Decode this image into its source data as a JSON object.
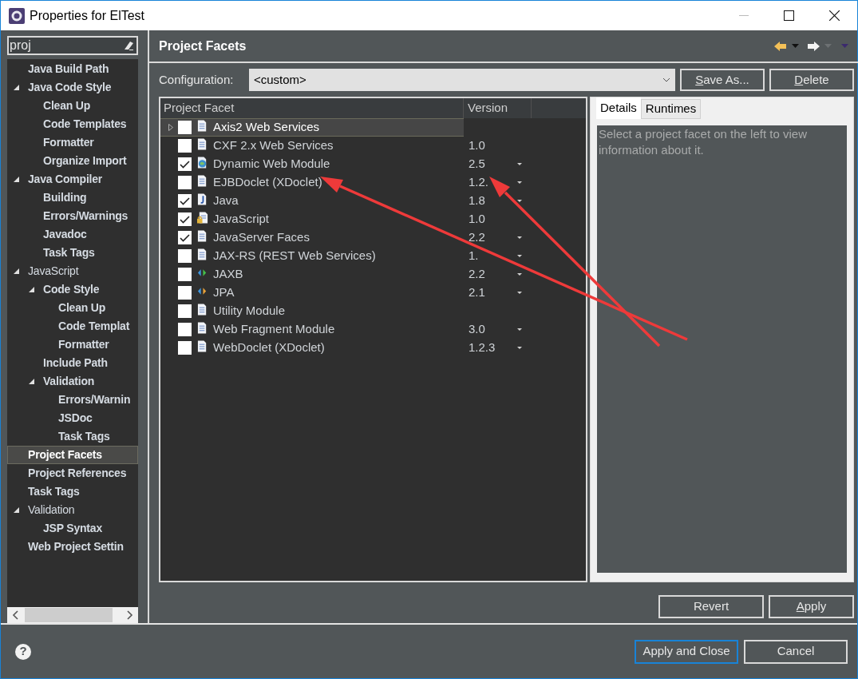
{
  "window": {
    "title": "Properties for ElTest"
  },
  "filter": {
    "value": "proj"
  },
  "tree": [
    {
      "label": "Java Build Path",
      "bold": true,
      "selected": false
    },
    {
      "label": "Java Code Style",
      "bold": true,
      "selected": false,
      "expanded": true,
      "children": [
        {
          "label": "Clean Up",
          "bold": true,
          "selected": false
        },
        {
          "label": "Code Templates",
          "bold": true,
          "selected": false
        },
        {
          "label": "Formatter",
          "bold": true,
          "selected": false
        },
        {
          "label": "Organize Import",
          "bold": true,
          "selected": false
        }
      ]
    },
    {
      "label": "Java Compiler",
      "bold": true,
      "selected": false,
      "expanded": true,
      "children": [
        {
          "label": "Building",
          "bold": true,
          "selected": false
        },
        {
          "label": "Errors/Warnings",
          "bold": true,
          "selected": false
        },
        {
          "label": "Javadoc",
          "bold": true,
          "selected": false
        },
        {
          "label": "Task Tags",
          "bold": true,
          "selected": false
        }
      ]
    },
    {
      "label": "JavaScript",
      "bold": false,
      "selected": false,
      "expanded": true,
      "children": [
        {
          "label": "Code Style",
          "bold": true,
          "selected": false,
          "expanded": true,
          "children": [
            {
              "label": "Clean Up",
              "bold": true,
              "selected": false
            },
            {
              "label": "Code Templat",
              "bold": true,
              "selected": false
            },
            {
              "label": "Formatter",
              "bold": true,
              "selected": false
            }
          ]
        },
        {
          "label": "Include Path",
          "bold": true,
          "selected": false
        },
        {
          "label": "Validation",
          "bold": true,
          "selected": false,
          "expanded": true,
          "children": [
            {
              "label": "Errors/Warnin",
              "bold": true,
              "selected": false
            },
            {
              "label": "JSDoc",
              "bold": true,
              "selected": false
            },
            {
              "label": "Task Tags",
              "bold": true,
              "selected": false
            }
          ]
        }
      ]
    },
    {
      "label": "Project Facets",
      "bold": true,
      "selected": true
    },
    {
      "label": "Project References",
      "bold": true,
      "selected": false
    },
    {
      "label": "Task Tags",
      "bold": true,
      "selected": false
    },
    {
      "label": "Validation",
      "bold": false,
      "selected": false,
      "expanded": true,
      "children": [
        {
          "label": "JSP Syntax",
          "bold": true,
          "selected": false
        }
      ]
    },
    {
      "label": "Web Project Settin",
      "bold": true,
      "selected": false
    }
  ],
  "page_title": "Project Facets",
  "configuration": {
    "label": "Configuration:",
    "value": "<custom>"
  },
  "config_buttons": [
    {
      "key": "S",
      "rest": "ave As..."
    },
    {
      "key": "D",
      "rest": "elete"
    }
  ],
  "table": {
    "columns": [
      "Project Facet",
      "Version"
    ],
    "rows": [
      {
        "name": "Axis2 Web Services",
        "kind": "doc",
        "checked": false,
        "selected": true,
        "expandable": true
      },
      {
        "name": "CXF 2.x Web Services",
        "kind": "doc",
        "checked": false,
        "selected": false,
        "version": "1.0",
        "dropdown": false
      },
      {
        "name": "Dynamic Web Module",
        "kind": "web",
        "checked": true,
        "selected": false,
        "version": "2.5",
        "dropdown": true
      },
      {
        "name": "EJBDoclet (XDoclet)",
        "kind": "doc",
        "checked": false,
        "selected": false,
        "version": "1.2.",
        "dropdown": true
      },
      {
        "name": "Java",
        "kind": "java",
        "checked": true,
        "selected": false,
        "version": "1.8",
        "dropdown": true
      },
      {
        "name": "JavaScript",
        "kind": "locked",
        "checked": true,
        "selected": false,
        "version": "1.0",
        "dropdown": false
      },
      {
        "name": "JavaServer Faces",
        "kind": "doc",
        "checked": true,
        "selected": false,
        "version": "2.2",
        "dropdown": true
      },
      {
        "name": "JAX-RS (REST Web Services)",
        "kind": "doc",
        "checked": false,
        "selected": false,
        "version": "1.",
        "dropdown": true
      },
      {
        "name": "JAXB",
        "kind": "green-arrows",
        "checked": false,
        "selected": false,
        "version": "2.2",
        "dropdown": true
      },
      {
        "name": "JPA",
        "kind": "orange-arrows",
        "checked": false,
        "selected": false,
        "version": "2.1",
        "dropdown": true
      },
      {
        "name": "Utility Module",
        "kind": "doc",
        "checked": false,
        "selected": false
      },
      {
        "name": "Web Fragment Module",
        "kind": "doc",
        "checked": false,
        "selected": false,
        "version": "3.0",
        "dropdown": true
      },
      {
        "name": "WebDoclet (XDoclet)",
        "kind": "doc",
        "checked": false,
        "selected": false,
        "version": "1.2.3",
        "dropdown": true
      }
    ]
  },
  "detail_tabs": [
    {
      "label": "Details",
      "selected": true
    },
    {
      "label": "Runtimes",
      "selected": false
    }
  ],
  "details_text": "Select a project facet on the left to view information about it.",
  "page_buttons": [
    {
      "label": "Revert"
    },
    {
      "key": "A",
      "rest": "pply"
    }
  ],
  "help": "?",
  "dialog_buttons": [
    {
      "label": "Apply and Close",
      "default": true
    },
    {
      "label": "Cancel",
      "default": false
    }
  ]
}
